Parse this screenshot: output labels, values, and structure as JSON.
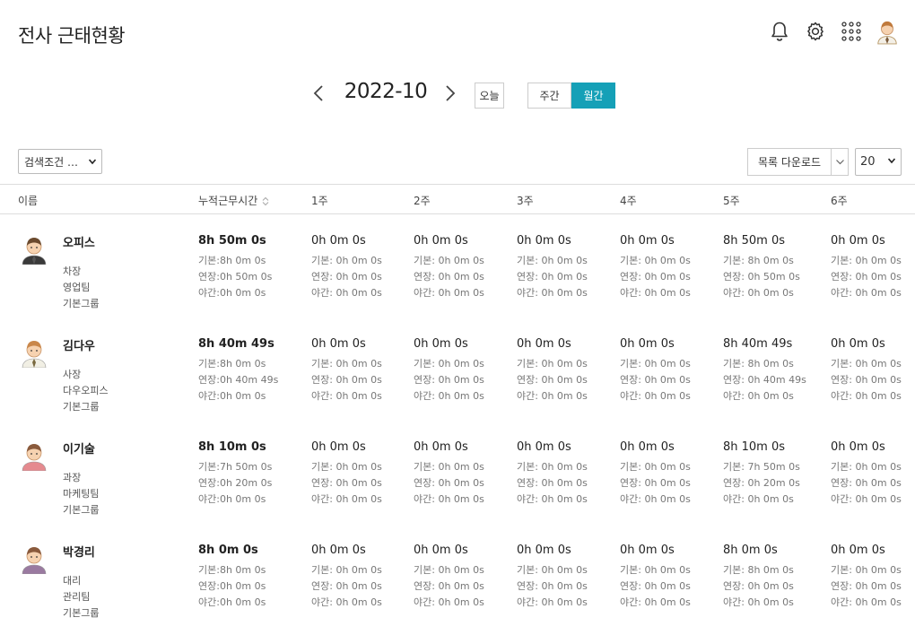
{
  "header": {
    "title": "전사 근태현황"
  },
  "icons": [
    "bell-icon",
    "gear-icon",
    "apps-grid-icon",
    "user-avatar"
  ],
  "period": {
    "label": "2022-10",
    "today": "오늘",
    "views": [
      {
        "label": "주간",
        "active": false
      },
      {
        "label": "월간",
        "active": true
      }
    ]
  },
  "toolbar": {
    "filter": "검색조건 …",
    "download": "목록 다운로드",
    "page_size": "20"
  },
  "colors": {
    "accent": "#15a0b7"
  },
  "table": {
    "headers": {
      "name": "이름",
      "total": "누적근무시간",
      "weeks": [
        "1주",
        "2주",
        "3주",
        "4주",
        "5주",
        "6주"
      ]
    },
    "rows": [
      {
        "name": "오피스",
        "position": "차장",
        "dept": "영업팀",
        "group": "기본그룹",
        "total": {
          "main": "8h 50m 0s",
          "basic": "기본:8h 0m 0s",
          "overtime": "연장:0h 50m 0s",
          "night": "야간:0h 0m 0s"
        },
        "weeks": [
          {
            "main": "0h 0m 0s",
            "basic": "기본: 0h 0m 0s",
            "overtime": "연장: 0h 0m 0s",
            "night": "야간: 0h 0m 0s"
          },
          {
            "main": "0h 0m 0s",
            "basic": "기본: 0h 0m 0s",
            "overtime": "연장: 0h 0m 0s",
            "night": "야간: 0h 0m 0s"
          },
          {
            "main": "0h 0m 0s",
            "basic": "기본: 0h 0m 0s",
            "overtime": "연장: 0h 0m 0s",
            "night": "야간: 0h 0m 0s"
          },
          {
            "main": "0h 0m 0s",
            "basic": "기본: 0h 0m 0s",
            "overtime": "연장: 0h 0m 0s",
            "night": "야간: 0h 0m 0s"
          },
          {
            "main": "8h 50m 0s",
            "basic": "기본: 8h 0m 0s",
            "overtime": "연장: 0h 50m 0s",
            "night": "야간: 0h 0m 0s"
          },
          {
            "main": "0h 0m 0s",
            "basic": "기본: 0h 0m 0s",
            "overtime": "연장: 0h 0m 0s",
            "night": "야간: 0h 0m 0s"
          }
        ]
      },
      {
        "name": "김다우",
        "position": "사장",
        "dept": "다우오피스",
        "group": "기본그룹",
        "total": {
          "main": "8h 40m 49s",
          "basic": "기본:8h 0m 0s",
          "overtime": "연장:0h 40m 49s",
          "night": "야간:0h 0m 0s"
        },
        "weeks": [
          {
            "main": "0h 0m 0s",
            "basic": "기본: 0h 0m 0s",
            "overtime": "연장: 0h 0m 0s",
            "night": "야간: 0h 0m 0s"
          },
          {
            "main": "0h 0m 0s",
            "basic": "기본: 0h 0m 0s",
            "overtime": "연장: 0h 0m 0s",
            "night": "야간: 0h 0m 0s"
          },
          {
            "main": "0h 0m 0s",
            "basic": "기본: 0h 0m 0s",
            "overtime": "연장: 0h 0m 0s",
            "night": "야간: 0h 0m 0s"
          },
          {
            "main": "0h 0m 0s",
            "basic": "기본: 0h 0m 0s",
            "overtime": "연장: 0h 0m 0s",
            "night": "야간: 0h 0m 0s"
          },
          {
            "main": "8h 40m 49s",
            "basic": "기본: 8h 0m 0s",
            "overtime": "연장: 0h 40m 49s",
            "night": "야간: 0h 0m 0s"
          },
          {
            "main": "0h 0m 0s",
            "basic": "기본: 0h 0m 0s",
            "overtime": "연장: 0h 0m 0s",
            "night": "야간: 0h 0m 0s"
          }
        ]
      },
      {
        "name": "이기술",
        "position": "과장",
        "dept": "마케팅팀",
        "group": "기본그룹",
        "total": {
          "main": "8h 10m 0s",
          "basic": "기본:7h 50m 0s",
          "overtime": "연장:0h 20m 0s",
          "night": "야간:0h 0m 0s"
        },
        "weeks": [
          {
            "main": "0h 0m 0s",
            "basic": "기본: 0h 0m 0s",
            "overtime": "연장: 0h 0m 0s",
            "night": "야간: 0h 0m 0s"
          },
          {
            "main": "0h 0m 0s",
            "basic": "기본: 0h 0m 0s",
            "overtime": "연장: 0h 0m 0s",
            "night": "야간: 0h 0m 0s"
          },
          {
            "main": "0h 0m 0s",
            "basic": "기본: 0h 0m 0s",
            "overtime": "연장: 0h 0m 0s",
            "night": "야간: 0h 0m 0s"
          },
          {
            "main": "0h 0m 0s",
            "basic": "기본: 0h 0m 0s",
            "overtime": "연장: 0h 0m 0s",
            "night": "야간: 0h 0m 0s"
          },
          {
            "main": "8h 10m 0s",
            "basic": "기본: 7h 50m 0s",
            "overtime": "연장: 0h 20m 0s",
            "night": "야간: 0h 0m 0s"
          },
          {
            "main": "0h 0m 0s",
            "basic": "기본: 0h 0m 0s",
            "overtime": "연장: 0h 0m 0s",
            "night": "야간: 0h 0m 0s"
          }
        ]
      },
      {
        "name": "박경리",
        "position": "대리",
        "dept": "관리팀",
        "group": "기본그룹",
        "total": {
          "main": "8h 0m 0s",
          "basic": "기본:8h 0m 0s",
          "overtime": "연장:0h 0m 0s",
          "night": "야간:0h 0m 0s"
        },
        "weeks": [
          {
            "main": "0h 0m 0s",
            "basic": "기본: 0h 0m 0s",
            "overtime": "연장: 0h 0m 0s",
            "night": "야간: 0h 0m 0s"
          },
          {
            "main": "0h 0m 0s",
            "basic": "기본: 0h 0m 0s",
            "overtime": "연장: 0h 0m 0s",
            "night": "야간: 0h 0m 0s"
          },
          {
            "main": "0h 0m 0s",
            "basic": "기본: 0h 0m 0s",
            "overtime": "연장: 0h 0m 0s",
            "night": "야간: 0h 0m 0s"
          },
          {
            "main": "0h 0m 0s",
            "basic": "기본: 0h 0m 0s",
            "overtime": "연장: 0h 0m 0s",
            "night": "야간: 0h 0m 0s"
          },
          {
            "main": "8h 0m 0s",
            "basic": "기본: 8h 0m 0s",
            "overtime": "연장: 0h 0m 0s",
            "night": "야간: 0h 0m 0s"
          },
          {
            "main": "0h 0m 0s",
            "basic": "기본: 0h 0m 0s",
            "overtime": "연장: 0h 0m 0s",
            "night": "야간: 0h 0m 0s"
          }
        ]
      }
    ]
  }
}
